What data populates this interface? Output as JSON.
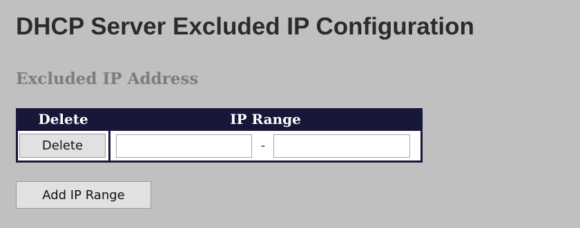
{
  "page": {
    "title": "DHCP Server Excluded IP Configuration",
    "section_title": "Excluded IP Address"
  },
  "table": {
    "headers": {
      "delete": "Delete",
      "ip_range": "IP Range"
    },
    "rows": [
      {
        "delete_label": "Delete",
        "start_ip": "",
        "separator": "-",
        "end_ip": ""
      }
    ]
  },
  "buttons": {
    "add_ip_range": "Add IP Range"
  },
  "colors": {
    "background": "#c0c0c0",
    "table_header": "#17173a",
    "title_text": "#2b2b2b",
    "section_text": "#7d7d7d"
  }
}
